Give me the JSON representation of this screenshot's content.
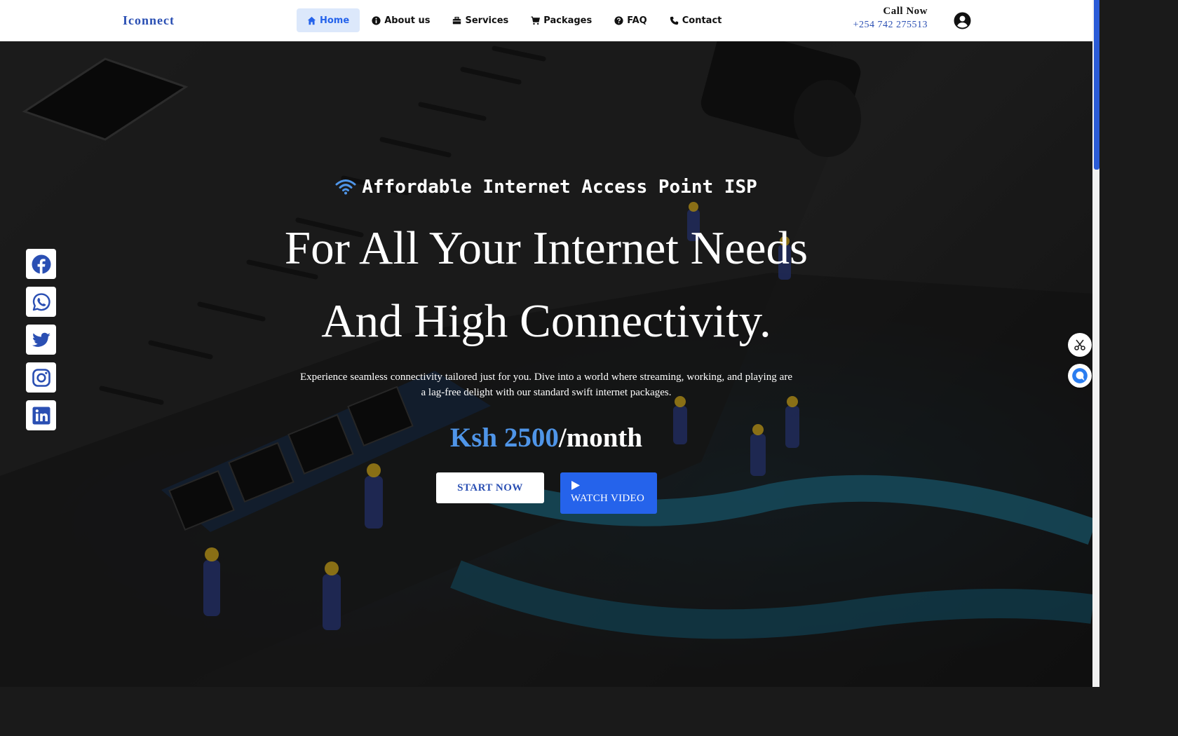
{
  "header": {
    "brand": "Iconnect",
    "nav": [
      {
        "label": "Home",
        "icon": "home-icon",
        "active": true
      },
      {
        "label": "About us",
        "icon": "info-icon"
      },
      {
        "label": "Services",
        "icon": "services-icon"
      },
      {
        "label": "Packages",
        "icon": "cart-icon"
      },
      {
        "label": "FAQ",
        "icon": "question-icon"
      },
      {
        "label": "Contact",
        "icon": "phone-icon"
      }
    ],
    "call_label": "Call Now",
    "call_number": "+254 742 275513",
    "user_icon": "user-circle-icon"
  },
  "hero": {
    "tagline": "Affordable Internet Access Point ISP",
    "tagline_icon": "wifi-icon",
    "headline_line1": "For All Your Internet Needs",
    "headline_line2": "And High Connectivity.",
    "description": "Experience seamless connectivity tailored just for you. Dive into a world where streaming, working, and playing are a lag-free delight with our standard swift internet packages.",
    "price_amount": "Ksh 2500",
    "price_period": "/month",
    "start_button": "START NOW",
    "video_button": "WATCH VIDEO",
    "video_icon": "play-icon"
  },
  "social": [
    {
      "name": "facebook-icon"
    },
    {
      "name": "whatsapp-icon"
    },
    {
      "name": "twitter-icon"
    },
    {
      "name": "instagram-icon"
    },
    {
      "name": "linkedin-icon"
    }
  ],
  "floating": [
    {
      "name": "scissors-icon"
    },
    {
      "name": "chat-icon"
    }
  ],
  "colors": {
    "brand_blue": "#2a4fb3",
    "accent_blue": "#2563eb",
    "price_blue": "#4f95e8",
    "nav_active_bg": "#dce8fb"
  }
}
